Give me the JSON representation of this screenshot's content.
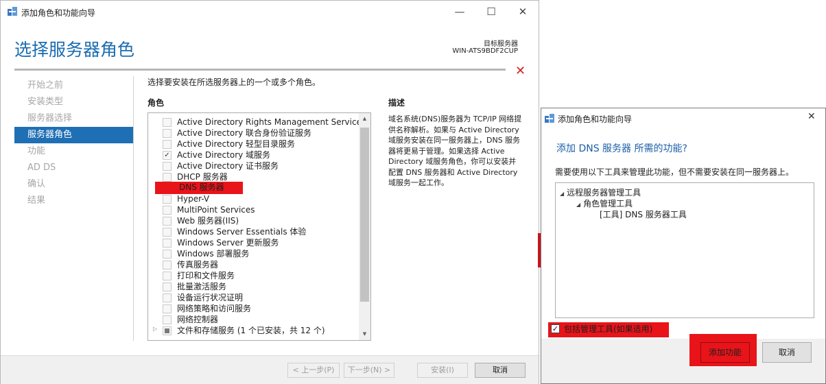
{
  "main_window": {
    "title": "添加角色和功能向导",
    "minimize_label": "—",
    "maximize_label": "☐",
    "close_label": "✕",
    "page_title": "选择服务器角色",
    "target_server_label": "目标服务器",
    "target_server_name": "WIN-ATS9BDF2CUP",
    "close_x": "✕",
    "nav": [
      {
        "label": "开始之前",
        "active": false
      },
      {
        "label": "安装类型",
        "active": false
      },
      {
        "label": "服务器选择",
        "active": false
      },
      {
        "label": "服务器角色",
        "active": true
      },
      {
        "label": "功能",
        "active": false
      },
      {
        "label": "AD DS",
        "active": false
      },
      {
        "label": "确认",
        "active": false
      },
      {
        "label": "结果",
        "active": false
      }
    ],
    "instruction": "选择要安装在所选服务器上的一个或多个角色。",
    "roles_heading": "角色",
    "description_heading": "描述",
    "description_text": "域名系统(DNS)服务器为 TCP/IP 网络提供名称解析。如果与 Active Directory 域服务安装在同一服务器上，DNS 服务器将更易于管理。如果选择 Active Directory 域服务角色，你可以安装并配置 DNS 服务器和 Active Directory 域服务一起工作。",
    "roles": [
      {
        "label": "Active Directory Rights Management Services",
        "checked": false
      },
      {
        "label": "Active Directory 联合身份验证服务",
        "checked": false
      },
      {
        "label": "Active Directory 轻型目录服务",
        "checked": false
      },
      {
        "label": "Active Directory 域服务",
        "checked": true
      },
      {
        "label": "Active Directory 证书服务",
        "checked": false
      },
      {
        "label": "DHCP 服务器",
        "checked": false
      },
      {
        "label": "DNS 服务器",
        "checked": false,
        "highlighted": true
      },
      {
        "label": "Hyper-V",
        "checked": false
      },
      {
        "label": "MultiPoint Services",
        "checked": false
      },
      {
        "label": "Web 服务器(IIS)",
        "checked": false
      },
      {
        "label": "Windows Server Essentials 体验",
        "checked": false
      },
      {
        "label": "Windows Server 更新服务",
        "checked": false
      },
      {
        "label": "Windows 部署服务",
        "checked": false
      },
      {
        "label": "传真服务器",
        "checked": false
      },
      {
        "label": "打印和文件服务",
        "checked": false
      },
      {
        "label": "批量激活服务",
        "checked": false
      },
      {
        "label": "设备运行状况证明",
        "checked": false
      },
      {
        "label": "网络策略和访问服务",
        "checked": false
      },
      {
        "label": "网络控制器",
        "checked": false
      },
      {
        "label": "文件和存储服务 (1 个已安装，共 12 个)",
        "checked": "partial",
        "expandable": true
      }
    ],
    "footer": {
      "prev": "< 上一步(P)",
      "next": "下一步(N) >",
      "install": "安装(I)",
      "cancel": "取消"
    }
  },
  "dialog": {
    "title": "添加角色和功能向导",
    "close_label": "✕",
    "heading": "添加 DNS 服务器 所需的功能?",
    "info": "需要使用以下工具来管理此功能，但不需要安装在同一服务器上。",
    "tree": [
      {
        "label": "远程服务器管理工具",
        "level": 0
      },
      {
        "label": "角色管理工具",
        "level": 1
      },
      {
        "label": "[工具] DNS 服务器工具",
        "level": 2
      }
    ],
    "include_tools_label": "包括管理工具(如果适用)",
    "include_tools_checked": true,
    "add_button": "添加功能",
    "cancel_button": "取消"
  },
  "colors": {
    "accent": "#1f6fb5",
    "highlight_red": "#e8141a",
    "title_blue": "#1a6cb0"
  }
}
